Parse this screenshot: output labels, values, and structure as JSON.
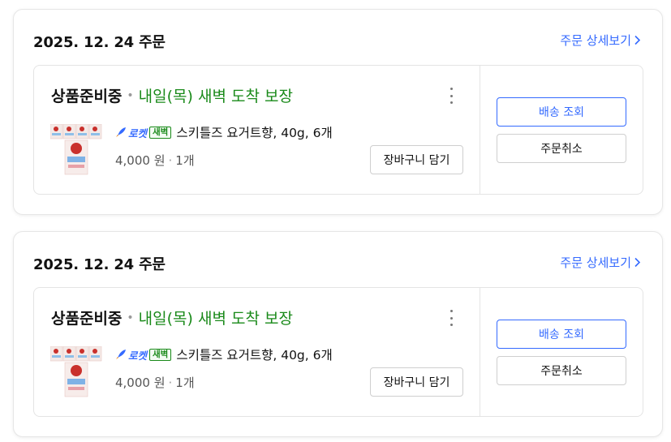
{
  "orders": [
    {
      "date_label": "2025. 12. 24 주문",
      "detail_link": "주문 상세보기",
      "status": "상품준비중",
      "arrival": "내일(목) 새벽 도착 보장",
      "rocket_label": "로켓",
      "dawn_label": "새벽",
      "product_name": "스키틀즈 요거트향, 40g, 6개",
      "price": "4,000 원",
      "quantity": "1개",
      "cart_button": "장바구니 담기",
      "ship_button": "배송 조회",
      "cancel_button": "주문취소"
    },
    {
      "date_label": "2025. 12. 24 주문",
      "detail_link": "주문 상세보기",
      "status": "상품준비중",
      "arrival": "내일(목) 새벽 도착 보장",
      "rocket_label": "로켓",
      "dawn_label": "새벽",
      "product_name": "스키틀즈 요거트향, 40g, 6개",
      "price": "4,000 원",
      "quantity": "1개",
      "cart_button": "장바구니 담기",
      "ship_button": "배송 조회",
      "cancel_button": "주문취소"
    }
  ],
  "icons": {
    "chevron": "chevron-right-icon",
    "menu": "more-vertical-icon",
    "rocket": "rocket-icon",
    "thumbnail": "product-thumbnail"
  },
  "colors": {
    "link": "#346aff",
    "arrival": "#1a8a1a",
    "border": "#e4e4e4"
  }
}
